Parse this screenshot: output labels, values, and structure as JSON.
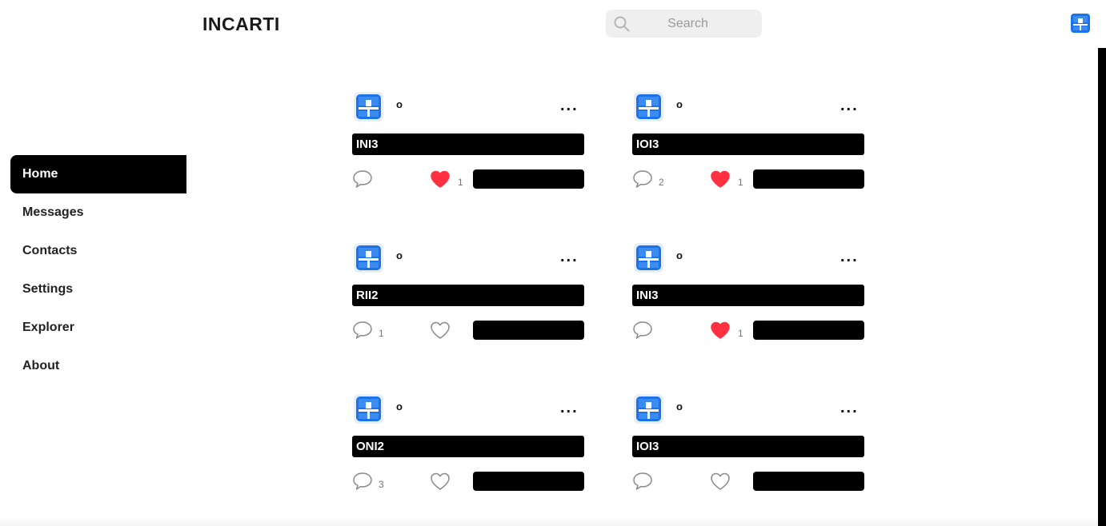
{
  "app": {
    "logo": "INCARTI"
  },
  "search": {
    "placeholder": "Search",
    "value": ""
  },
  "colors": {
    "accent": "#1a73e8",
    "heart_active": "#ff3040",
    "active_nav_bg": "#000000"
  },
  "sidebar": {
    "items": [
      {
        "label": "Home",
        "active": true
      },
      {
        "label": "Messages",
        "active": false
      },
      {
        "label": "Contacts",
        "active": false
      },
      {
        "label": "Settings",
        "active": false
      },
      {
        "label": "Explorer",
        "active": false
      },
      {
        "label": "About",
        "active": false
      }
    ]
  },
  "posts": [
    {
      "username": "o",
      "more": "...",
      "title": "INI3",
      "comments": "",
      "liked": true,
      "likes": "1"
    },
    {
      "username": "o",
      "more": "...",
      "title": "IOI3",
      "comments": "2",
      "liked": true,
      "likes": "1"
    },
    {
      "username": "o",
      "more": "...",
      "title": "RII2",
      "comments": "1",
      "liked": false,
      "likes": ""
    },
    {
      "username": "o",
      "more": "...",
      "title": "INI3",
      "comments": "",
      "liked": true,
      "likes": "1"
    },
    {
      "username": "o",
      "more": "...",
      "title": "ONI2",
      "comments": "3",
      "liked": false,
      "likes": ""
    },
    {
      "username": "o",
      "more": "...",
      "title": "IOI3",
      "comments": "",
      "liked": false,
      "likes": ""
    }
  ]
}
